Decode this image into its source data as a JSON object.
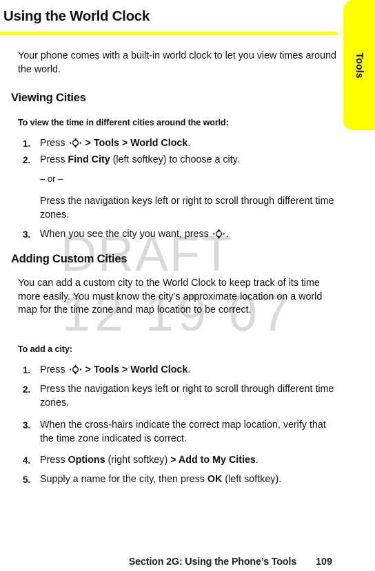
{
  "page": {
    "title": "Using the World Clock",
    "accent_color": "#ffff00",
    "text_color": "#111111"
  },
  "side_tab": {
    "label": "Tools",
    "color": "#ffff00"
  },
  "watermark": {
    "line1": "DRAFT",
    "line2": "12 19 07",
    "color": "#d9d9d9"
  },
  "intro": {
    "paragraph": "Your phone comes with a built-in world clock to let you view times around the world."
  },
  "sections": [
    {
      "heading": "Viewing Cities",
      "lead": "To view the time in different cities around the world:",
      "steps": [
        {
          "number": "1.",
          "parts": [
            {
              "type": "text",
              "value": "Press "
            },
            {
              "type": "icon",
              "value": "navigation-key-icon"
            },
            {
              "type": "text",
              "value": " "
            },
            {
              "type": "bold",
              "value": "> Tools > World Clock"
            },
            {
              "type": "text",
              "value": "."
            }
          ]
        },
        {
          "number": "2.",
          "parts": [
            {
              "type": "text",
              "value": "Press "
            },
            {
              "type": "bold",
              "value": "Find City"
            },
            {
              "type": "text",
              "value": " (left softkey) to choose a city."
            }
          ]
        },
        {
          "number": "3.",
          "parts": [
            {
              "type": "text",
              "value": "When you see the city you want, press "
            },
            {
              "type": "icon",
              "value": "navigation-key-icon"
            },
            {
              "type": "text",
              "value": "."
            }
          ]
        }
      ],
      "alternative": {
        "separator": "– or –",
        "text": "Press the navigation keys left or right to scroll through different time zones."
      }
    },
    {
      "heading": "Adding Custom Cities",
      "paragraph": "You can add a custom city to the World Clock to keep track of its time more easily. You must know the city’s approximate location on a world map for the time zone and map location to be correct.",
      "lead": "To add a city:",
      "steps": [
        {
          "number": "1.",
          "parts": [
            {
              "type": "text",
              "value": "Press "
            },
            {
              "type": "icon",
              "value": "navigation-key-icon"
            },
            {
              "type": "text",
              "value": " "
            },
            {
              "type": "bold",
              "value": "> Tools > World Clock"
            },
            {
              "type": "text",
              "value": "."
            }
          ]
        },
        {
          "number": "2.",
          "parts": [
            {
              "type": "text",
              "value": "Press the navigation keys left or right to scroll through different time zones."
            }
          ]
        },
        {
          "number": "3.",
          "parts": [
            {
              "type": "text",
              "value": "When the cross-hairs indicate the correct map location, verify that the time zone indicated is correct."
            }
          ]
        },
        {
          "number": "4.",
          "parts": [
            {
              "type": "text",
              "value": "Press "
            },
            {
              "type": "bold",
              "value": "Options"
            },
            {
              "type": "text",
              "value": " (right softkey) "
            },
            {
              "type": "bold",
              "value": "> Add to My Cities"
            },
            {
              "type": "text",
              "value": "."
            }
          ]
        },
        {
          "number": "5.",
          "parts": [
            {
              "type": "text",
              "value": "Supply a name for the city, then press "
            },
            {
              "type": "bold",
              "value": "OK"
            },
            {
              "type": "text",
              "value": " (left softkey)."
            }
          ]
        }
      ]
    }
  ],
  "footer": {
    "section_label": "Section 2G: Using the Phone’s Tools",
    "page_number": "109"
  }
}
